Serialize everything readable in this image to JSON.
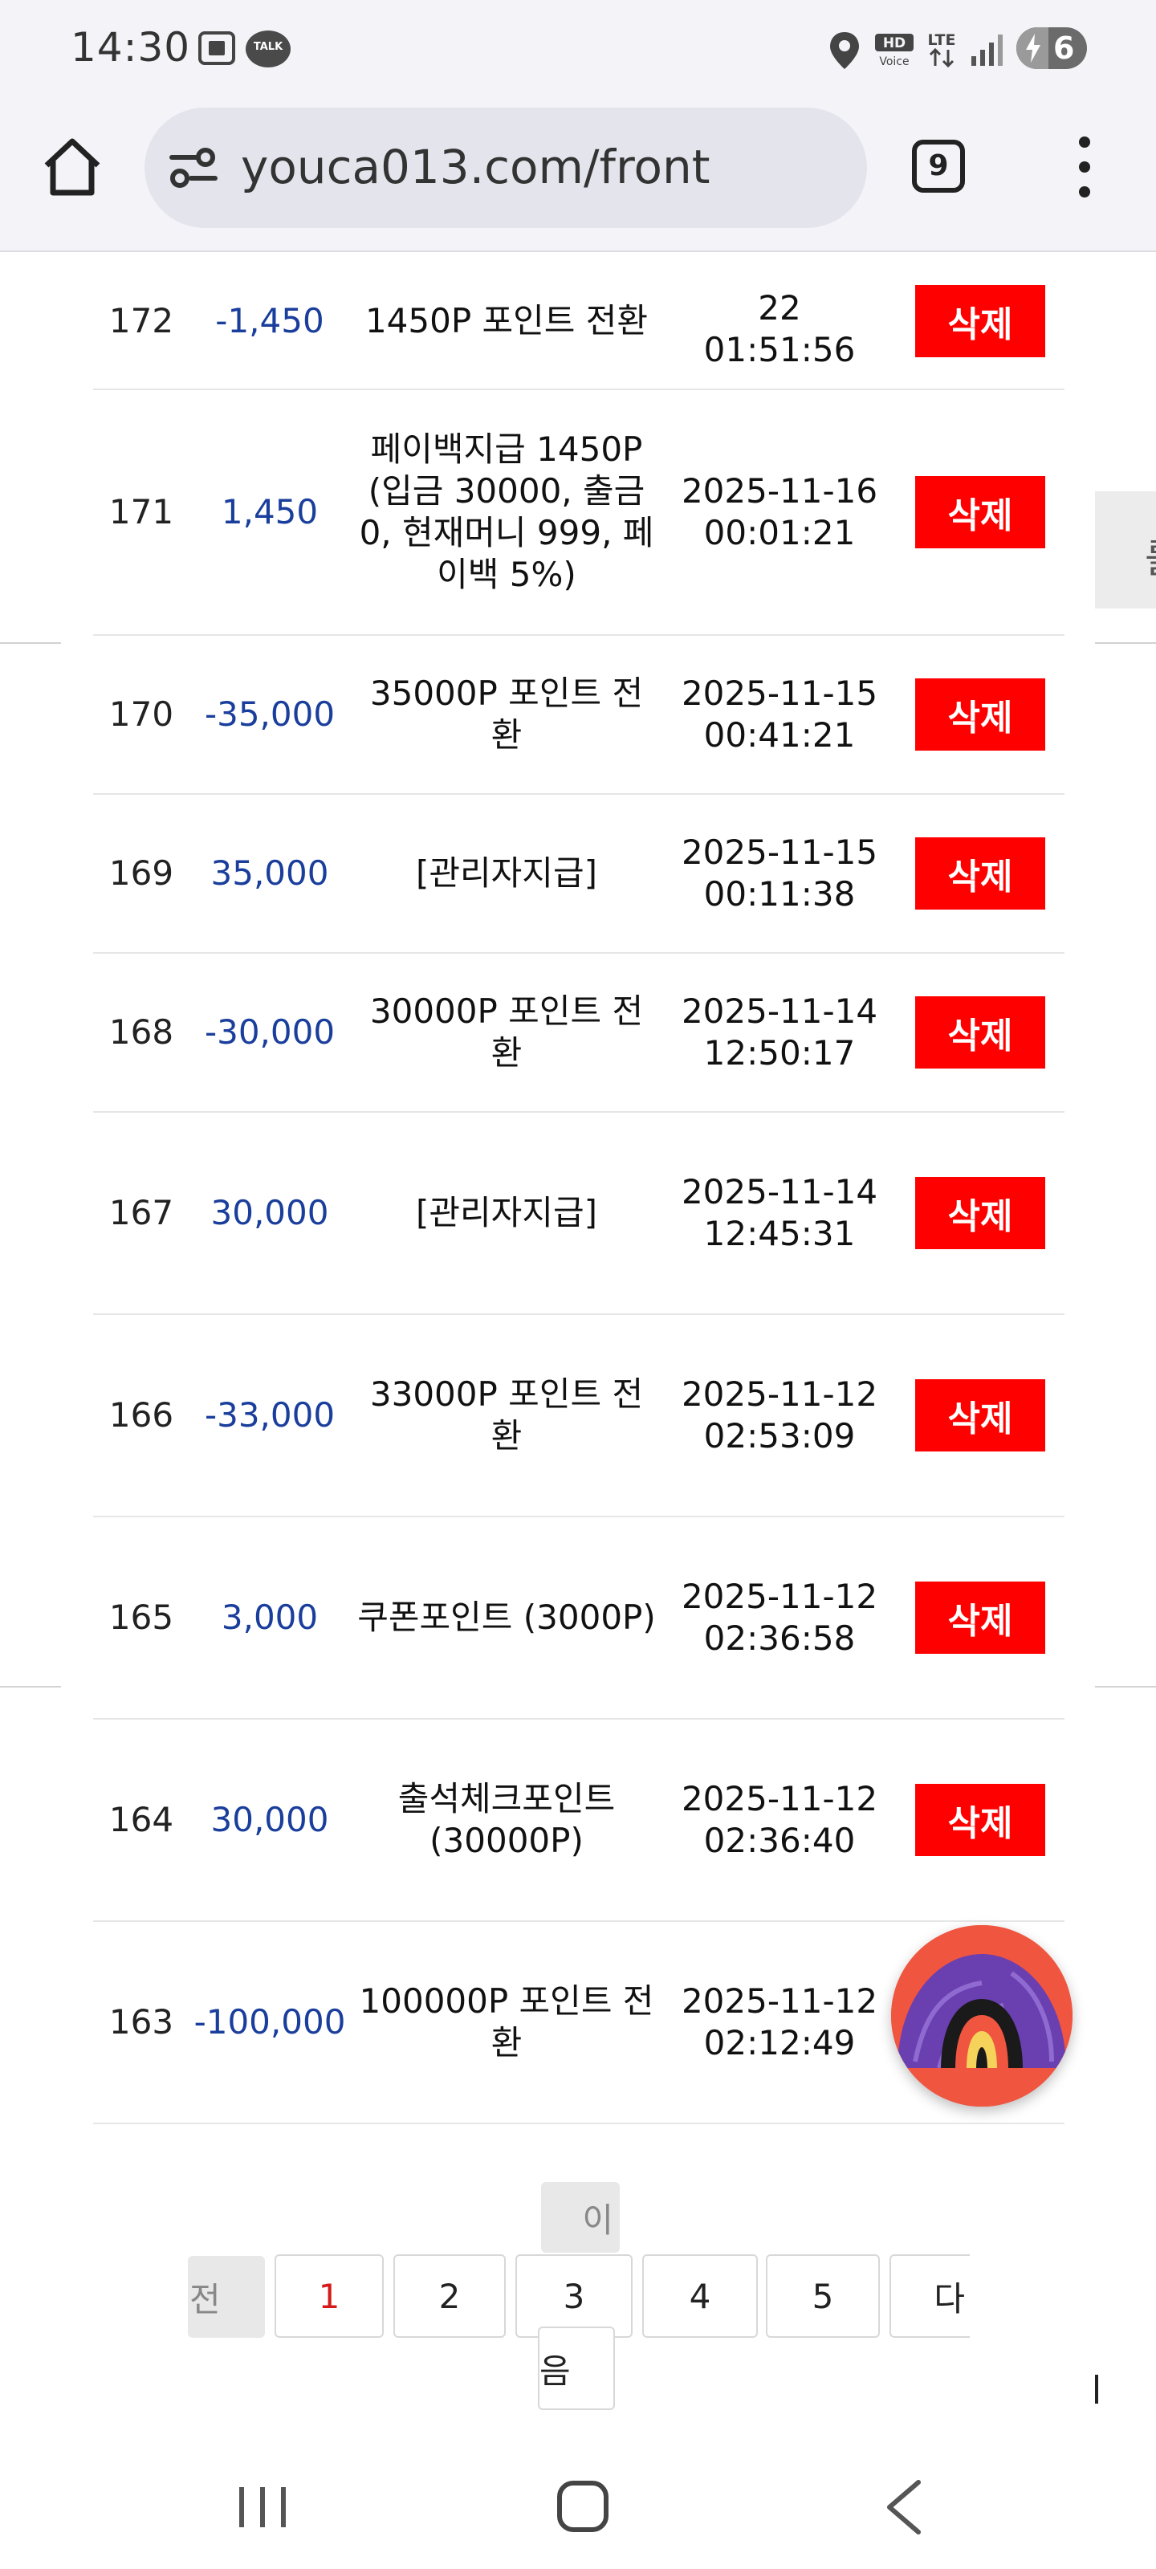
{
  "status_bar": {
    "time": "14:30",
    "talk_label": "TALK",
    "hd_label": "HD",
    "voice_label": "Voice",
    "lte_label": "LTE",
    "battery_level": "6"
  },
  "browser": {
    "url": "youca013.com/front",
    "tab_count": "9"
  },
  "table": {
    "rows": [
      {
        "no": "172",
        "amount": "-1,450",
        "desc": "1450P 포인트 전환",
        "date": "22\n01:51:56",
        "action": "삭제"
      },
      {
        "no": "171",
        "amount": "1,450",
        "desc": "페이백지급 1450P (입금 30000, 출금 0, 현재머니 999, 페이백 5%)",
        "date": "2025-11-16 00:01:21",
        "action": "삭제"
      },
      {
        "no": "170",
        "amount": "-35,000",
        "desc": "35000P 포인트 전환",
        "date": "2025-11-15 00:41:21",
        "action": "삭제"
      },
      {
        "no": "169",
        "amount": "35,000",
        "desc": "[관리자지급]",
        "date": "2025-11-15 00:11:38",
        "action": "삭제"
      },
      {
        "no": "168",
        "amount": "-30,000",
        "desc": "30000P 포인트 전환",
        "date": "2025-11-14 12:50:17",
        "action": "삭제"
      },
      {
        "no": "167",
        "amount": "30,000",
        "desc": "[관리자지급]",
        "date": "2025-11-14 12:45:31",
        "action": "삭제"
      },
      {
        "no": "166",
        "amount": "-33,000",
        "desc": "33000P 포인트 전환",
        "date": "2025-11-12 02:53:09",
        "action": "삭제"
      },
      {
        "no": "165",
        "amount": "3,000",
        "desc": "쿠폰포인트 (3000P)",
        "date": "2025-11-12 02:36:58",
        "action": "삭제"
      },
      {
        "no": "164",
        "amount": "30,000",
        "desc": "출석체크포인트 (30000P)",
        "date": "2025-11-12 02:36:40",
        "action": "삭제"
      },
      {
        "no": "163",
        "amount": "-100,000",
        "desc": "100000P 포인트 전환",
        "date": "2025-11-12 02:12:49",
        "action": ""
      }
    ]
  },
  "pagination": {
    "prev_part1": "이",
    "prev_part2": "전",
    "pages": [
      "1",
      "2",
      "3",
      "4",
      "5"
    ],
    "active_page": "1",
    "next_part1": "다",
    "next_part2": "음"
  },
  "right_stub_char": "를",
  "colors": {
    "delete_button": "#ff0000",
    "amount_text": "#1a3e9c",
    "active_page": "#d41a1a",
    "fab_background": "#f05540"
  }
}
